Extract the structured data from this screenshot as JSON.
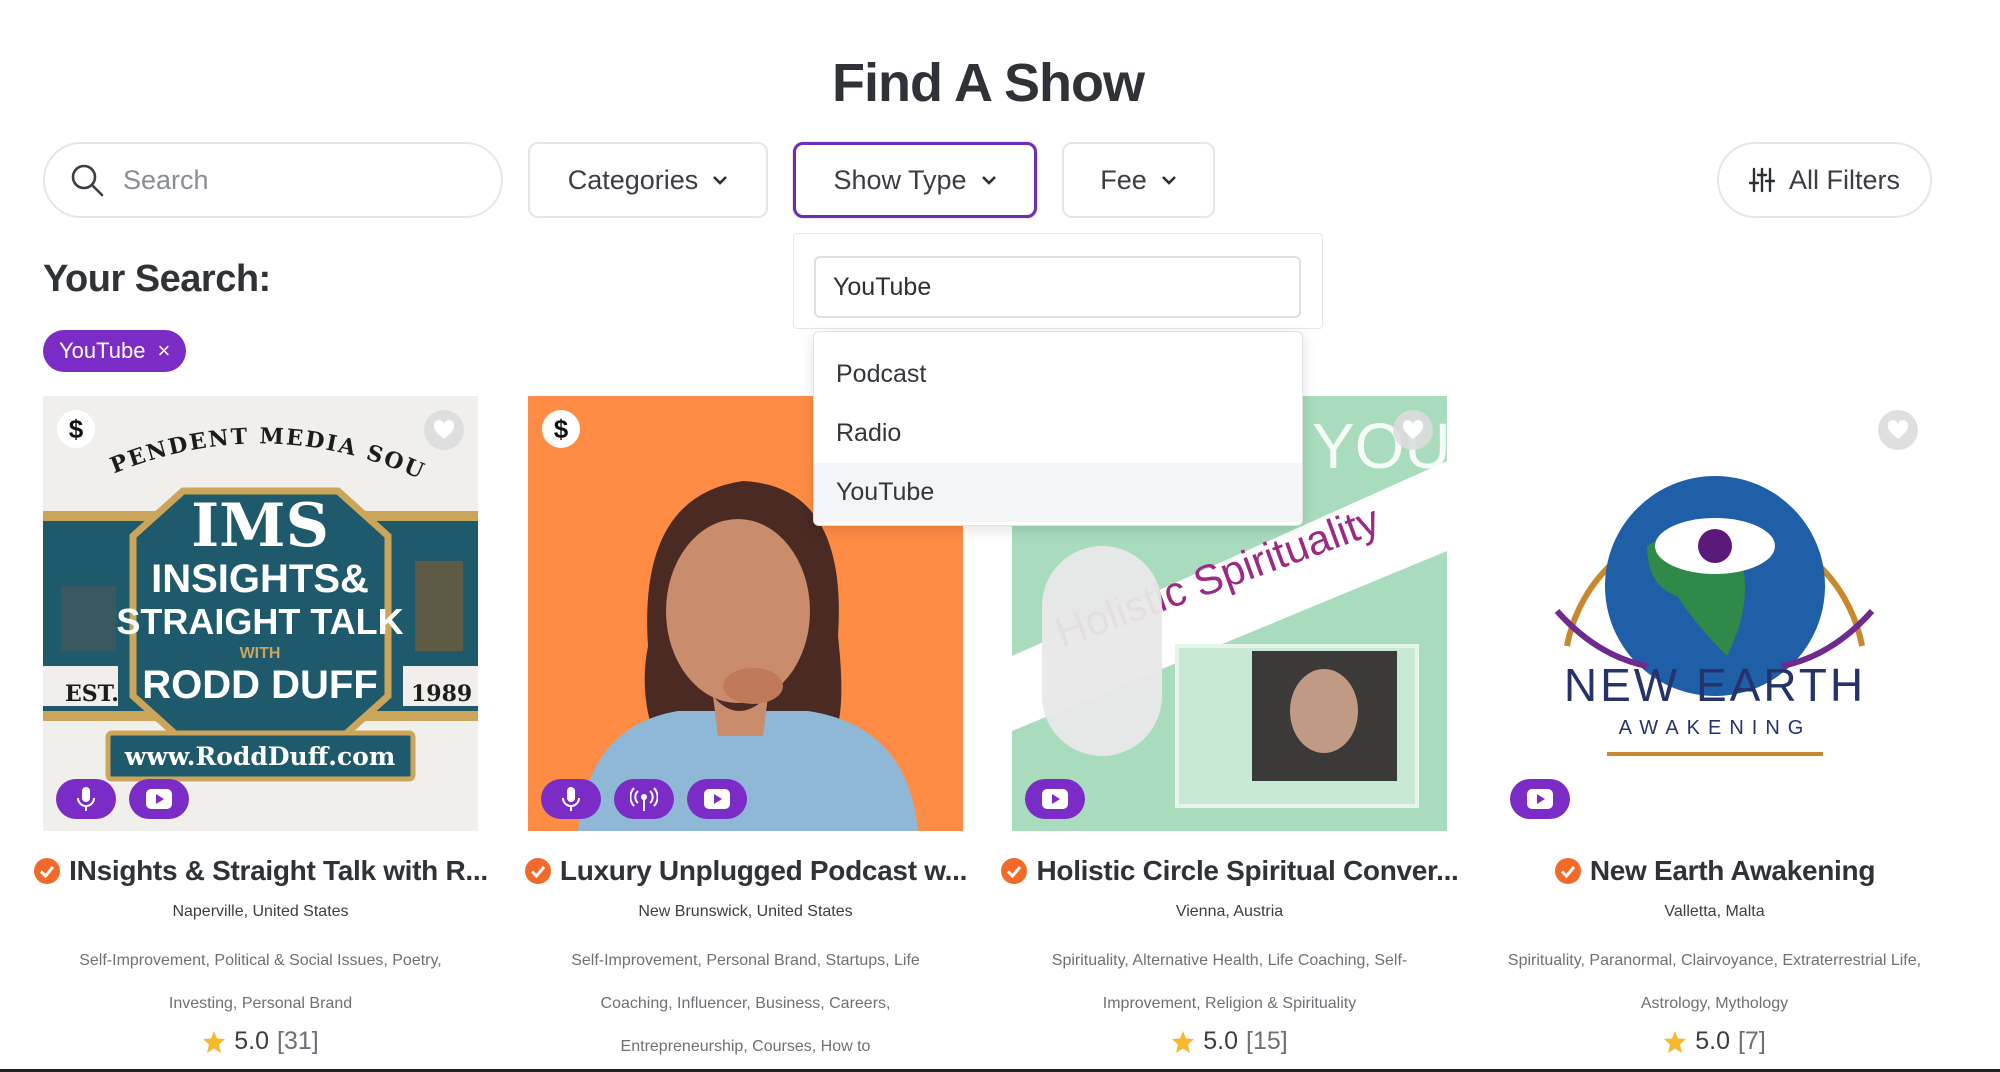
{
  "page": {
    "title": "Find A Show"
  },
  "filters": {
    "search_placeholder": "Search",
    "categories_label": "Categories",
    "show_type_label": "Show Type",
    "fee_label": "Fee",
    "all_filters_label": "All Filters"
  },
  "show_type_dropdown": {
    "input_value": "YouTube",
    "options": [
      "Podcast",
      "Radio",
      "YouTube"
    ],
    "highlighted": "YouTube"
  },
  "your_search": {
    "heading": "Your Search:",
    "chips": [
      {
        "label": "YouTube",
        "remove_icon": "×"
      }
    ]
  },
  "colors": {
    "accent": "#7b2cc7",
    "verified": "#f26a2a",
    "star": "#f5b82e"
  },
  "cards": [
    {
      "title": "INsights & Straight Talk with R...",
      "location": "Naperville, United States",
      "categories": "Self-Improvement, Political & Social Issues, Poetry, Investing, Personal Brand",
      "rating": "5.0",
      "reviews": "[31]",
      "paid": true,
      "badges": [
        "microphone-icon",
        "youtube-icon"
      ],
      "art": {
        "top_text": "INDEPENDENT MEDIA SOURCE",
        "line1": "IMS",
        "line2": "INSIGHTS&",
        "line3": "STRAIGHT TALK",
        "line4": "WITH",
        "line5": "RODD DUFF",
        "est": "EST.",
        "year": "1989",
        "url": "www.RoddDuff.com"
      }
    },
    {
      "title": "Luxury Unplugged Podcast w...",
      "location": "New Brunswick, United States",
      "categories": "Self-Improvement, Personal Brand, Startups, Life Coaching, Influencer, Business, Careers, Entrepreneurship, Courses, How to",
      "paid": true,
      "badges": [
        "microphone-icon",
        "radio-icon",
        "youtube-icon"
      ]
    },
    {
      "title": "Holistic Circle Spiritual Conver...",
      "location": "Vienna, Austria",
      "categories": "Spirituality, Alternative Health, Life Coaching, Self-Improvement, Religion & Spirituality",
      "rating": "5.0",
      "reviews": "[15]",
      "paid": false,
      "badges": [
        "youtube-icon"
      ],
      "art": {
        "banner": "Holistic Spirituality",
        "corner": "YOU"
      }
    },
    {
      "title": "New Earth Awakening",
      "location": "Valletta, Malta",
      "categories": "Spirituality, Paranormal, Clairvoyance, Extraterrestrial Life, Astrology, Mythology",
      "rating": "5.0",
      "reviews": "[7]",
      "paid": false,
      "badges": [
        "youtube-icon"
      ],
      "art": {
        "line1": "NEW EARTH",
        "line2": "AWAKENING"
      }
    }
  ]
}
